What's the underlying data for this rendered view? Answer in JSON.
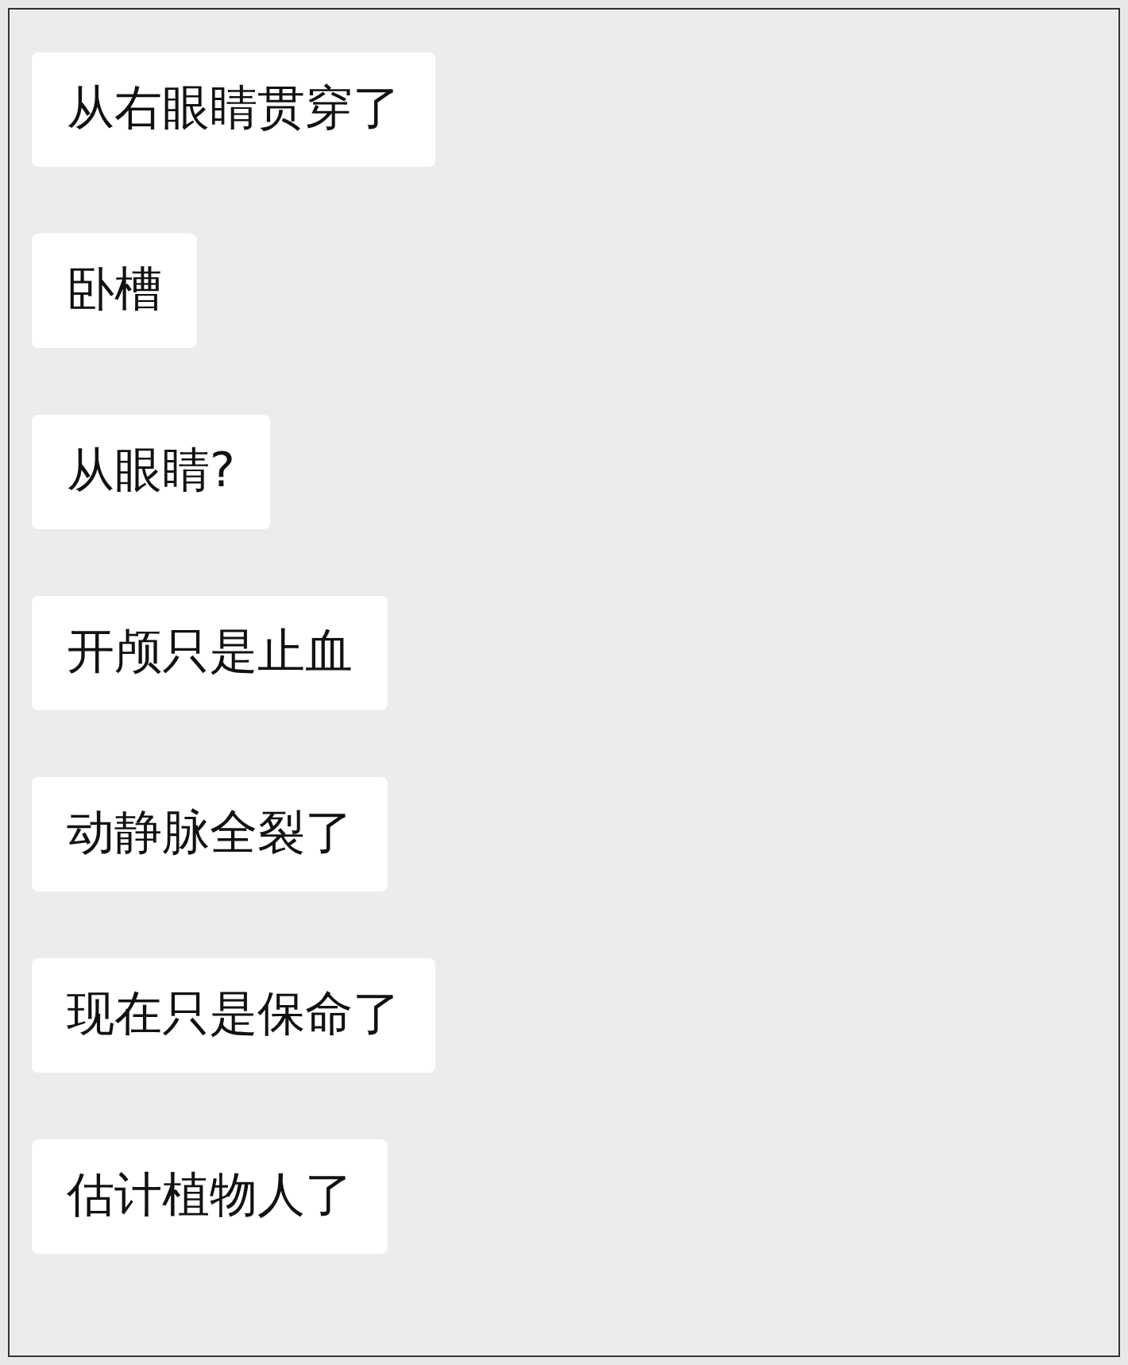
{
  "messages": [
    {
      "text": "从右眼睛贯穿了"
    },
    {
      "text": "卧槽"
    },
    {
      "text": "从眼睛?"
    },
    {
      "text": "开颅只是止血"
    },
    {
      "text": "动静脉全裂了"
    },
    {
      "text": "现在只是保命了"
    },
    {
      "text": "估计植物人了"
    }
  ]
}
